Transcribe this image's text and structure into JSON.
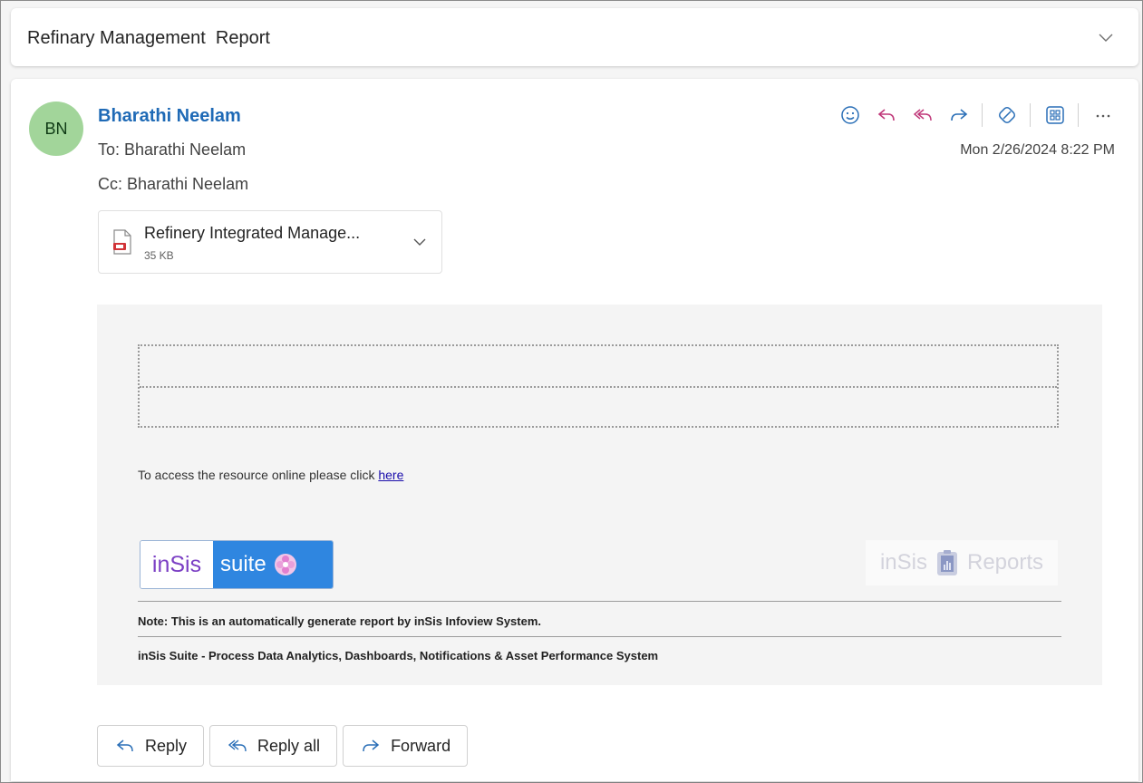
{
  "subject": {
    "title": "Refinary Management  Report"
  },
  "sender": {
    "initials": "BN",
    "name": "Bharathi Neelam",
    "to": "To: Bharathi Neelam",
    "cc": "Cc: Bharathi Neelam",
    "timestamp": "Mon 2/26/2024 8:22 PM",
    "avatar_color": "#a2d59a"
  },
  "toolbar": {
    "icons": [
      "smiley-icon",
      "reply-icon",
      "reply-all-icon",
      "forward-icon",
      "sticker-icon",
      "apps-icon",
      "more-icon"
    ]
  },
  "attachment": {
    "name": "Refinery Integrated Manage...",
    "size": "35 KB",
    "icon": "pdf-file-icon"
  },
  "body": {
    "access_text": "To access the resource online please click ",
    "access_link": "here",
    "logo_left_part1": "inSis",
    "logo_left_part2": "suite",
    "logo_right_part1": "inSis",
    "logo_right_part2": "Reports",
    "note": "Note: This is an automatically generate report by inSis Infoview System.",
    "suite_line": "inSis Suite - Process Data Analytics, Dashboards, Notifications & Asset Performance System"
  },
  "reply_bar": {
    "reply": "Reply",
    "reply_all": "Reply all",
    "forward": "Forward"
  },
  "colors": {
    "accent": "#1f6ab6",
    "link": "#1a0dab",
    "toolbar_icon": "#c0397a"
  }
}
